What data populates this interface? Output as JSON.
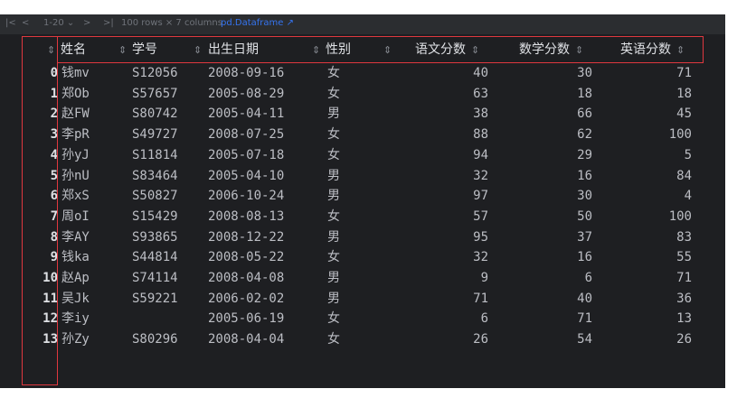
{
  "toolbar": {
    "first": "|<",
    "prev": "<",
    "range": "1-20",
    "next": ">",
    "last": ">|",
    "summary": "100 rows × 7 columns",
    "link": "pd.Dataframe",
    "link_icon": "external-link-icon"
  },
  "columns": {
    "index_sort": "⇕",
    "name": "姓名",
    "id": "学号",
    "birth": "出生日期",
    "gender": "性别",
    "chinese": "语文分数",
    "math": "数学分数",
    "english": "英语分数",
    "sort_glyph": "⇕"
  },
  "rows": [
    {
      "i": "0",
      "name": "钱mv",
      "id": "S12056",
      "birth": "2008-09-16",
      "gender": "女",
      "chinese": "40",
      "math": "30",
      "english": "71"
    },
    {
      "i": "1",
      "name": "郑Ob",
      "id": "S57657",
      "birth": "2005-08-29",
      "gender": "女",
      "chinese": "63",
      "math": "18",
      "english": "18"
    },
    {
      "i": "2",
      "name": "赵FW",
      "id": "S80742",
      "birth": "2005-04-11",
      "gender": "男",
      "chinese": "38",
      "math": "66",
      "english": "45"
    },
    {
      "i": "3",
      "name": "李pR",
      "id": "S49727",
      "birth": "2008-07-25",
      "gender": "女",
      "chinese": "88",
      "math": "62",
      "english": "100"
    },
    {
      "i": "4",
      "name": "孙yJ",
      "id": "S11814",
      "birth": "2005-07-18",
      "gender": "女",
      "chinese": "94",
      "math": "29",
      "english": "5"
    },
    {
      "i": "5",
      "name": "孙nU",
      "id": "S83464",
      "birth": "2005-04-10",
      "gender": "男",
      "chinese": "32",
      "math": "16",
      "english": "84"
    },
    {
      "i": "6",
      "name": "郑xS",
      "id": "S50827",
      "birth": "2006-10-24",
      "gender": "男",
      "chinese": "97",
      "math": "30",
      "english": "4"
    },
    {
      "i": "7",
      "name": "周oI",
      "id": "S15429",
      "birth": "2008-08-13",
      "gender": "女",
      "chinese": "57",
      "math": "50",
      "english": "100"
    },
    {
      "i": "8",
      "name": "李AY",
      "id": "S93865",
      "birth": "2008-12-22",
      "gender": "男",
      "chinese": "95",
      "math": "37",
      "english": "83"
    },
    {
      "i": "9",
      "name": "钱ka",
      "id": "S44814",
      "birth": "2008-05-22",
      "gender": "女",
      "chinese": "32",
      "math": "16",
      "english": "55"
    },
    {
      "i": "10",
      "name": "赵Ap",
      "id": "S74114",
      "birth": "2008-04-08",
      "gender": "男",
      "chinese": "9",
      "math": "6",
      "english": "71"
    },
    {
      "i": "11",
      "name": "吴Jk",
      "id": "S59221",
      "birth": "2006-02-02",
      "gender": "男",
      "chinese": "71",
      "math": "40",
      "english": "36"
    },
    {
      "i": "12",
      "name": "李iy",
      "id": "",
      "birth": "2005-06-19",
      "gender": "女",
      "chinese": "6",
      "math": "71",
      "english": "13"
    },
    {
      "i": "13",
      "name": "孙Zy",
      "id": "S80296",
      "birth": "2008-04-04",
      "gender": "女",
      "chinese": "26",
      "math": "54",
      "english": "26"
    }
  ]
}
